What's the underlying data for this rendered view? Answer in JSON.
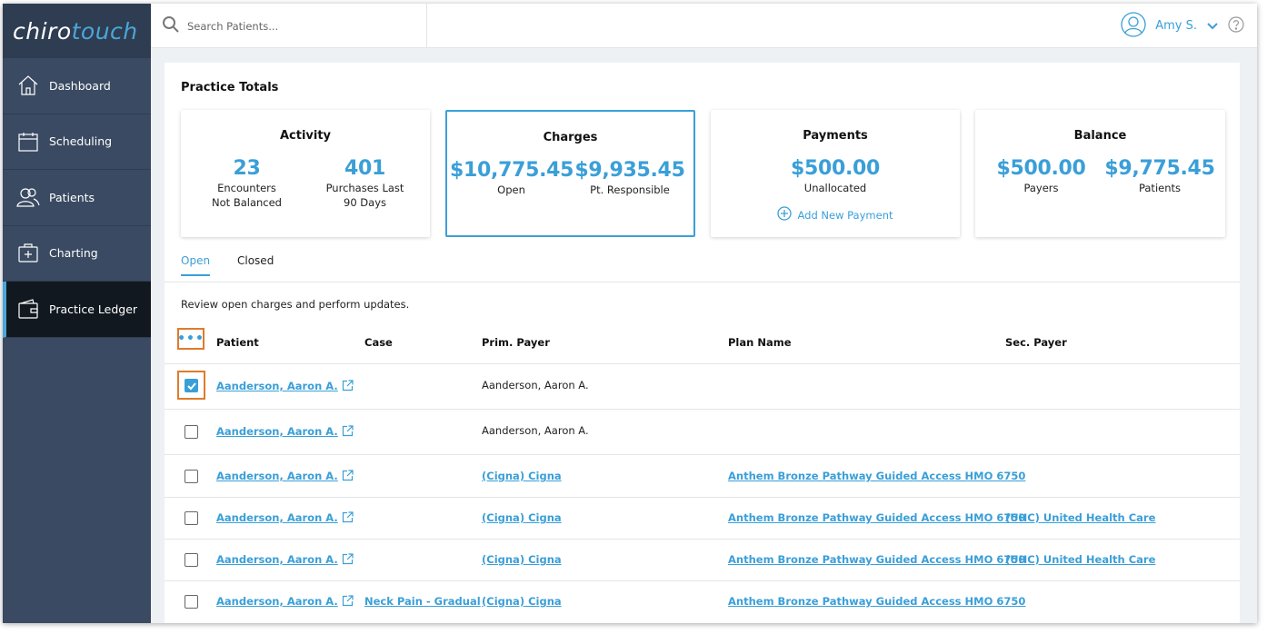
{
  "app": {
    "logo_part1": "chiro",
    "logo_part2": "touch"
  },
  "sidebar": {
    "items": [
      {
        "label": "Dashboard",
        "icon": "home-icon"
      },
      {
        "label": "Scheduling",
        "icon": "calendar-icon"
      },
      {
        "label": "Patients",
        "icon": "patients-icon"
      },
      {
        "label": "Charting",
        "icon": "charting-icon"
      },
      {
        "label": "Practice Ledger",
        "icon": "wallet-icon",
        "active": true
      }
    ]
  },
  "topbar": {
    "search_placeholder": "Search Patients...",
    "user_name": "Amy S."
  },
  "practice_totals": {
    "title": "Practice Totals",
    "activity": {
      "title": "Activity",
      "encounters_value": "23",
      "encounters_label_1": "Encounters",
      "encounters_label_2": "Not Balanced",
      "purchases_value": "401",
      "purchases_label_1": "Purchases Last",
      "purchases_label_2": "90 Days"
    },
    "charges": {
      "title": "Charges",
      "open_value": "$10,775.45",
      "open_label": "Open",
      "pt_value": "$9,935.45",
      "pt_label": "Pt. Responsible"
    },
    "payments": {
      "title": "Payments",
      "unallocated_value": "$500.00",
      "unallocated_label": "Unallocated",
      "add_label": "Add New Payment"
    },
    "balance": {
      "title": "Balance",
      "payers_value": "$500.00",
      "payers_label": "Payers",
      "patients_value": "$9,775.45",
      "patients_label": "Patients"
    }
  },
  "tabs": {
    "open": "Open",
    "closed": "Closed"
  },
  "description": "Review open charges and perform updates.",
  "table": {
    "menu_label": "•••",
    "headers": {
      "patient": "Patient",
      "case": "Case",
      "prim_payer": "Prim. Payer",
      "plan_name": "Plan Name",
      "sec_payer": "Sec. Payer"
    },
    "rows": [
      {
        "patient": "Aanderson, Aaron A.",
        "case": "",
        "prim_payer": "Aanderson, Aaron A.",
        "prim_link": false,
        "plan_name": "",
        "sec_payer": "",
        "checked": true
      },
      {
        "patient": "Aanderson, Aaron A.",
        "case": "",
        "prim_payer": "Aanderson, Aaron A.",
        "prim_link": false,
        "plan_name": "",
        "sec_payer": "",
        "checked": false
      },
      {
        "patient": "Aanderson, Aaron A.",
        "case": "",
        "prim_payer": "(Cigna) Cigna",
        "prim_link": true,
        "plan_name": "Anthem Bronze Pathway Guided Access HMO 6750",
        "sec_payer": "",
        "checked": false
      },
      {
        "patient": "Aanderson, Aaron A.",
        "case": "",
        "prim_payer": "(Cigna) Cigna",
        "prim_link": true,
        "plan_name": "Anthem Bronze Pathway Guided Access HMO 6750",
        "sec_payer": "(UHC) United Health Care",
        "checked": false
      },
      {
        "patient": "Aanderson, Aaron A.",
        "case": "",
        "prim_payer": "(Cigna) Cigna",
        "prim_link": true,
        "plan_name": "Anthem Bronze Pathway Guided Access HMO 6750",
        "sec_payer": "(UHC) United Health Care",
        "checked": false
      },
      {
        "patient": "Aanderson, Aaron A.",
        "case": "Neck Pain - Gradual",
        "prim_payer": "(Cigna) Cigna",
        "prim_link": true,
        "plan_name": "Anthem Bronze Pathway Guided Access HMO 6750",
        "sec_payer": "",
        "checked": false
      }
    ]
  },
  "colors": {
    "accent": "#3a9fd8",
    "sidebar": "#3a4a62",
    "highlight": "#e07b2a"
  }
}
